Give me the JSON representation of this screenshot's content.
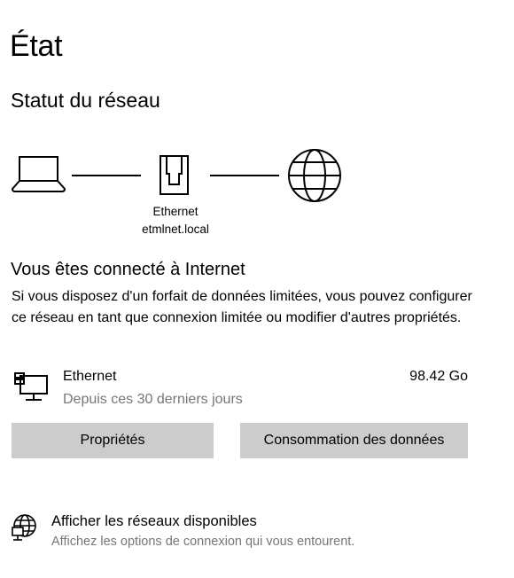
{
  "page": {
    "title": "État"
  },
  "network_status": {
    "heading": "Statut du réseau",
    "diagram": {
      "adapter_label": "Ethernet",
      "network_label": "etmlnet.local",
      "icons": [
        "laptop-icon",
        "ethernet-icon",
        "globe-icon"
      ]
    }
  },
  "connection": {
    "heading": "Vous êtes connecté à Internet",
    "description": "Si vous disposez d'un forfait de données limitées, vous pouvez configurer ce réseau en tant que connexion limitée ou modifier d'autres propriétés."
  },
  "adapter": {
    "icon": "network-adapter-icon",
    "name": "Ethernet",
    "period": "Depuis ces 30 derniers jours",
    "usage": "98.42 Go"
  },
  "buttons": {
    "properties": "Propriétés",
    "data_usage": "Consommation des données"
  },
  "available_networks": {
    "icon": "available-networks-icon",
    "title": "Afficher les réseaux disponibles",
    "subtitle": "Affichez les options de connexion qui vous entourent."
  },
  "colors": {
    "background": "#ffffff",
    "text": "#000000",
    "secondary_text": "#767676",
    "button_bg": "#cccccc"
  }
}
